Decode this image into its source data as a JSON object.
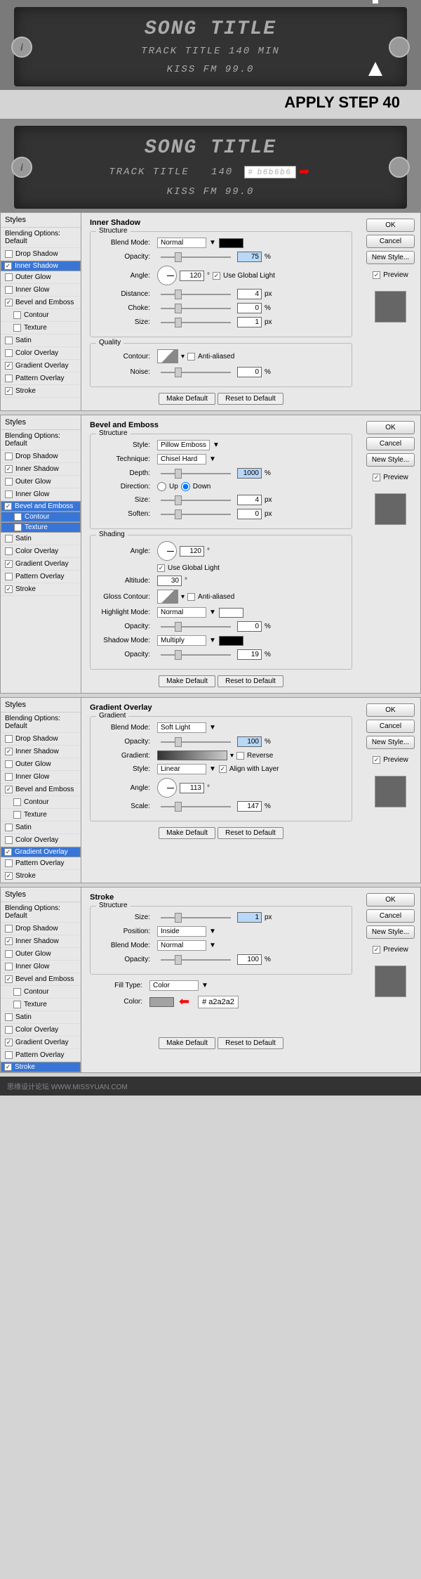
{
  "watermark": "思缘设计论坛  WWW.MISSYUAN.COM",
  "lcd": {
    "song": "SONG TITLE",
    "track": "TRACK TITLE  140 MIN",
    "station": "KISS FM 99.0"
  },
  "apply": "APPLY STEP 40",
  "color1": {
    "hash": "#",
    "val": "b6b6b6"
  },
  "color2": {
    "hash": "#",
    "val": "a2a2a2"
  },
  "styles_hdr": "Styles",
  "blending": "Blending Options: Default",
  "items": {
    "drop": "Drop Shadow",
    "inner_s": "Inner Shadow",
    "outer_g": "Outer Glow",
    "inner_g": "Inner Glow",
    "bevel": "Bevel and Emboss",
    "contour": "Contour",
    "texture": "Texture",
    "satin": "Satin",
    "color_o": "Color Overlay",
    "grad_o": "Gradient Overlay",
    "pat_o": "Pattern Overlay",
    "stroke": "Stroke"
  },
  "rbtns": {
    "ok": "OK",
    "cancel": "Cancel",
    "newstyle": "New Style...",
    "preview": "Preview"
  },
  "sections": {
    "inner": {
      "title": "Inner Shadow",
      "struct": "Structure",
      "quality": "Quality",
      "blend": "Blend Mode:",
      "blend_v": "Normal",
      "opacity": "Opacity:",
      "opacity_v": "75",
      "angle": "Angle:",
      "angle_v": "120",
      "global": "Use Global Light",
      "dist": "Distance:",
      "dist_v": "4",
      "choke": "Choke:",
      "choke_v": "0",
      "size": "Size:",
      "size_v": "1",
      "contour": "Contour:",
      "anti": "Anti-aliased",
      "noise": "Noise:",
      "noise_v": "0",
      "pct": "%",
      "px": "px",
      "deg": "°"
    },
    "bevel": {
      "title": "Bevel and Emboss",
      "struct": "Structure",
      "shading": "Shading",
      "style": "Style:",
      "style_v": "Pillow Emboss",
      "tech": "Technique:",
      "tech_v": "Chisel Hard",
      "depth": "Depth:",
      "depth_v": "1000",
      "dir": "Direction:",
      "up": "Up",
      "down": "Down",
      "size": "Size:",
      "size_v": "4",
      "soften": "Soften:",
      "soften_v": "0",
      "angle": "Angle:",
      "angle_v": "120",
      "global": "Use Global Light",
      "alt": "Altitude:",
      "alt_v": "30",
      "gloss": "Gloss Contour:",
      "anti": "Anti-aliased",
      "hmode": "Highlight Mode:",
      "hmode_v": "Normal",
      "hop": "Opacity:",
      "hop_v": "0",
      "smode": "Shadow Mode:",
      "smode_v": "Multiply",
      "sop": "Opacity:",
      "sop_v": "19"
    },
    "grad": {
      "title": "Gradient Overlay",
      "grad": "Gradient",
      "blend": "Blend Mode:",
      "blend_v": "Soft Light",
      "opacity": "Opacity:",
      "opacity_v": "100",
      "gradient": "Gradient:",
      "reverse": "Reverse",
      "style": "Style:",
      "style_v": "Linear",
      "align": "Align with Layer",
      "angle": "Angle:",
      "angle_v": "113",
      "scale": "Scale:",
      "scale_v": "147"
    },
    "stroke": {
      "title": "Stroke",
      "struct": "Structure",
      "size": "Size:",
      "size_v": "1",
      "pos": "Position:",
      "pos_v": "Inside",
      "blend": "Blend Mode:",
      "blend_v": "Normal",
      "opacity": "Opacity:",
      "opacity_v": "100",
      "fill": "Fill Type:",
      "fill_v": "Color",
      "color": "Color:"
    }
  },
  "btns": {
    "make": "Make Default",
    "reset": "Reset to Default"
  },
  "footer": "思缘设计论坛  WWW.MISSYUAN.COM"
}
